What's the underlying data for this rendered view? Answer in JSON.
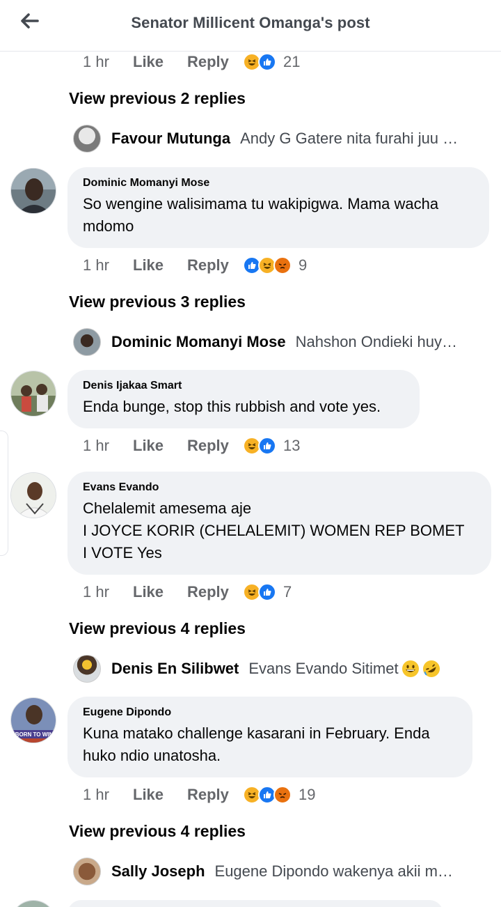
{
  "header": {
    "title": "Senator Millicent Omanga's post"
  },
  "meta_labels": {
    "like": "Like",
    "reply": "Reply"
  },
  "rows": [
    {
      "time": "1 hr",
      "count": "21",
      "reactions": [
        "haha",
        "like"
      ]
    },
    {
      "time": "1 hr",
      "count": "9",
      "reactions": [
        "like",
        "haha",
        "angry"
      ]
    },
    {
      "time": "1 hr",
      "count": "13",
      "reactions": [
        "haha",
        "like"
      ]
    },
    {
      "time": "1 hr",
      "count": "7",
      "reactions": [
        "haha",
        "like"
      ]
    },
    {
      "time": "1 hr",
      "count": "19",
      "reactions": [
        "haha",
        "like",
        "angry"
      ]
    }
  ],
  "view_previous": [
    "View previous 2 replies",
    "View previous 3 replies",
    "View previous 4 replies",
    "View previous 4 replies"
  ],
  "reply_previews": [
    {
      "name": "Favour Mutunga",
      "text": "Andy G Gatere nita furahi juu …"
    },
    {
      "name": "Dominic Momanyi Mose",
      "text": "Nahshon Ondieki huy…"
    },
    {
      "name": "Denis En Silibwet",
      "text": "Evans Evando Sitimet"
    },
    {
      "name": "Sally Joseph",
      "text": "Eugene Dipondo wakenya akii m…"
    }
  ],
  "comments": [
    {
      "author": "Dominic Momanyi Mose",
      "body": "So wengine walisimama tu wakipigwa. Mama wacha\nmdomo"
    },
    {
      "author": "Denis Ijakaa Smart",
      "body": "Enda bunge, stop this rubbish and vote yes."
    },
    {
      "author": "Evans Evando",
      "body": "Chelalemit amesema aje\nI JOYCE KORIR (CHELALEMIT) WOMEN REP BOMET\nI VOTE Yes"
    },
    {
      "author": "Eugene Dipondo",
      "body": "Kuna matako challenge kasarani in February. Enda\nhuko ndio unatosha."
    }
  ],
  "avatar_banner_text": "BORN TO WIN",
  "colors": {
    "haha": "#f7b125",
    "like": "#1877f2",
    "angry": "#e9710f",
    "bubble": "#f0f2f5",
    "muted": "#65676b"
  }
}
